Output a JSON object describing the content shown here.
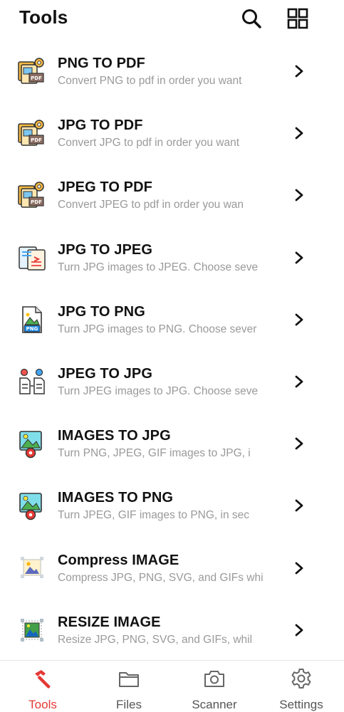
{
  "header": {
    "title": "Tools",
    "search_icon": "search-icon",
    "grid_icon": "grid-view-icon"
  },
  "tools": [
    {
      "title": "PNG TO PDF",
      "description": "Convert PNG to pdf in order you want",
      "icon": "images-to-pdf-icon"
    },
    {
      "title": "JPG TO PDF",
      "description": "Convert JPG to pdf in order you want",
      "icon": "images-to-pdf-icon"
    },
    {
      "title": "JPEG TO PDF",
      "description": "Convert JPEG to pdf in order you wan",
      "icon": "images-to-pdf-icon"
    },
    {
      "title": "JPG TO JPEG",
      "description": "Turn JPG images to JPEG. Choose seve",
      "icon": "document-convert-icon"
    },
    {
      "title": "JPG TO PNG",
      "description": "Turn JPG images to PNG. Choose sever",
      "icon": "png-file-icon"
    },
    {
      "title": "JPEG TO JPG",
      "description": "Turn JPEG images to JPG. Choose seve",
      "icon": "file-transfer-icon"
    },
    {
      "title": "IMAGES TO JPG",
      "description": "Turn PNG, JPEG, GIF images to JPG, i",
      "icon": "image-settings-icon"
    },
    {
      "title": "IMAGES TO PNG",
      "description": "Turn JPEG, GIF images to PNG, in sec",
      "icon": "image-settings-icon"
    },
    {
      "title": "Compress IMAGE",
      "description": "Compress JPG, PNG, SVG, and GIFs whi",
      "icon": "compress-image-icon"
    },
    {
      "title": "RESIZE IMAGE",
      "description": "Resize JPG, PNG, SVG, and GIFs, whil",
      "icon": "resize-image-icon"
    }
  ],
  "bottom_nav": {
    "active": "Tools",
    "active_color": "#e53935",
    "tabs": [
      {
        "label": "Tools",
        "icon": "hammer-icon"
      },
      {
        "label": "Files",
        "icon": "folder-icon"
      },
      {
        "label": "Scanner",
        "icon": "camera-icon"
      },
      {
        "label": "Settings",
        "icon": "gear-icon"
      }
    ]
  }
}
